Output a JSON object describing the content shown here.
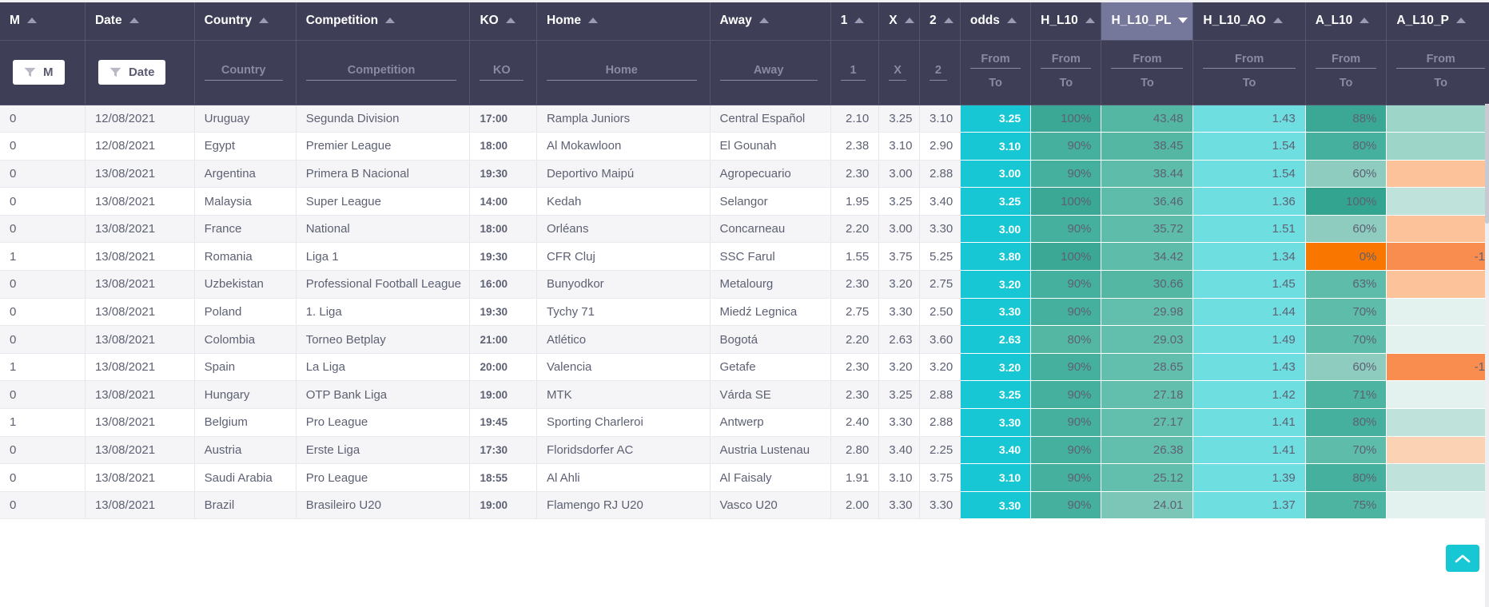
{
  "columns": [
    {
      "key": "m",
      "label": "M",
      "sort": "asc",
      "filter_type": "pill",
      "filter_label": "M",
      "active": false
    },
    {
      "key": "date",
      "label": "Date",
      "sort": "asc",
      "filter_type": "pill",
      "filter_label": "Date",
      "active": false
    },
    {
      "key": "country",
      "label": "Country",
      "sort": "asc",
      "filter_type": "text",
      "filter_label": "Country",
      "active": false
    },
    {
      "key": "comp",
      "label": "Competition",
      "sort": "asc",
      "filter_type": "text",
      "filter_label": "Competition",
      "active": false
    },
    {
      "key": "ko",
      "label": "KO",
      "sort": "asc",
      "filter_type": "text",
      "filter_label": "KO",
      "active": false
    },
    {
      "key": "home",
      "label": "Home",
      "sort": "asc",
      "filter_type": "text",
      "filter_label": "Home",
      "active": false
    },
    {
      "key": "away",
      "label": "Away",
      "sort": "asc",
      "filter_type": "text",
      "filter_label": "Away",
      "active": false
    },
    {
      "key": "one",
      "label": "1",
      "sort": "asc",
      "filter_type": "text",
      "filter_label": "1",
      "active": false
    },
    {
      "key": "x",
      "label": "X",
      "sort": "asc",
      "filter_type": "text",
      "filter_label": "X",
      "active": false
    },
    {
      "key": "two",
      "label": "2",
      "sort": "asc",
      "filter_type": "text",
      "filter_label": "2",
      "active": false
    },
    {
      "key": "odds",
      "label": "odds",
      "sort": "asc",
      "filter_type": "range",
      "filter_from": "From",
      "filter_to": "To",
      "active": false
    },
    {
      "key": "h_l10",
      "label": "H_L10",
      "sort": "asc",
      "filter_type": "range",
      "filter_from": "From",
      "filter_to": "To",
      "active": false
    },
    {
      "key": "h_l10_pl",
      "label": "H_L10_PL",
      "sort": "desc",
      "filter_type": "range",
      "filter_from": "From",
      "filter_to": "To",
      "active": true
    },
    {
      "key": "h_l10_ao",
      "label": "H_L10_AO",
      "sort": "asc",
      "filter_type": "range",
      "filter_from": "From",
      "filter_to": "To",
      "active": false
    },
    {
      "key": "a_l10",
      "label": "A_L10",
      "sort": "asc",
      "filter_type": "range",
      "filter_from": "From",
      "filter_to": "To",
      "active": false
    },
    {
      "key": "a_l10_p",
      "label": "A_L10_P",
      "sort": "asc",
      "filter_type": "range",
      "filter_from": "From",
      "filter_to": "To",
      "active": false
    }
  ],
  "colors": {
    "header_bg": "#3e3e56",
    "header_active_bg": "#75779b",
    "odds_cyan": "#17c8d4",
    "teal_dark": "#3aa894",
    "teal_mid": "#54b7a3",
    "teal_light": "#8fccc0",
    "cyan_light": "#6fdee0",
    "orange_strong": "#f97600",
    "orange_mid": "#f98d4f",
    "orange_light": "#fcc29a",
    "orange_pale": "#fcd2b4",
    "mint_pale": "#e4f2ef",
    "mint_light": "#bfe2da",
    "mint_soft": "#9ed5c9",
    "row_odd": "#ffffff",
    "row_even": "#f5f5f7",
    "text": "#5d6173"
  },
  "rows": [
    {
      "m": "0",
      "date": "12/08/2021",
      "country": "Uruguay",
      "comp": "Segunda Division",
      "ko": "17:00",
      "home": "Rampla Juniors",
      "away": "Central Español",
      "one": "2.10",
      "x": "3.25",
      "two": "3.10",
      "odds": "3.25",
      "h_l10": "100%",
      "h_l10_pl": "43.48",
      "h_l10_ao": "1.43",
      "a_l10": "88%",
      "a_l10_p": "",
      "c_h_l10": "#3aa894",
      "c_h_l10_pl": "#54b7a3",
      "c_h_l10_ao": "#6fdee0",
      "c_a_l10": "#3aa894",
      "c_a_l10_p": "#9ed5c9"
    },
    {
      "m": "0",
      "date": "12/08/2021",
      "country": "Egypt",
      "comp": "Premier League",
      "ko": "18:00",
      "home": "Al Mokawloon",
      "away": "El Gounah",
      "one": "2.38",
      "x": "3.10",
      "two": "2.90",
      "odds": "3.10",
      "h_l10": "90%",
      "h_l10_pl": "38.45",
      "h_l10_ao": "1.54",
      "a_l10": "80%",
      "a_l10_p": "",
      "c_h_l10": "#45b09d",
      "c_h_l10_pl": "#54b7a3",
      "c_h_l10_ao": "#6fdee0",
      "c_a_l10": "#45b09d",
      "c_a_l10_p": "#9ed5c9"
    },
    {
      "m": "0",
      "date": "13/08/2021",
      "country": "Argentina",
      "comp": "Primera B Nacional",
      "ko": "19:30",
      "home": "Deportivo Maipú",
      "away": "Agropecuario",
      "one": "2.30",
      "x": "3.00",
      "two": "2.88",
      "odds": "3.00",
      "h_l10": "90%",
      "h_l10_pl": "38.44",
      "h_l10_ao": "1.54",
      "a_l10": "60%",
      "a_l10_p": "",
      "c_h_l10": "#45b09d",
      "c_h_l10_pl": "#5dbcaa",
      "c_h_l10_ao": "#6fdee0",
      "c_a_l10": "#8fccc0",
      "c_a_l10_p": "#fcc29a"
    },
    {
      "m": "0",
      "date": "13/08/2021",
      "country": "Malaysia",
      "comp": "Super League",
      "ko": "14:00",
      "home": "Kedah",
      "away": "Selangor",
      "one": "1.95",
      "x": "3.25",
      "two": "3.40",
      "odds": "3.25",
      "h_l10": "100%",
      "h_l10_pl": "36.46",
      "h_l10_ao": "1.36",
      "a_l10": "100%",
      "a_l10_p": "",
      "c_h_l10": "#3aa894",
      "c_h_l10_pl": "#5dbcaa",
      "c_h_l10_ao": "#6fdee0",
      "c_a_l10": "#33a48f",
      "c_a_l10_p": "#bfe2da"
    },
    {
      "m": "0",
      "date": "13/08/2021",
      "country": "France",
      "comp": "National",
      "ko": "18:00",
      "home": "Orléans",
      "away": "Concarneau",
      "one": "2.20",
      "x": "3.00",
      "two": "3.30",
      "odds": "3.00",
      "h_l10": "90%",
      "h_l10_pl": "35.72",
      "h_l10_ao": "1.51",
      "a_l10": "60%",
      "a_l10_p": "",
      "c_h_l10": "#45b09d",
      "c_h_l10_pl": "#5dbcaa",
      "c_h_l10_ao": "#6fdee0",
      "c_a_l10": "#8fccc0",
      "c_a_l10_p": "#fcc29a"
    },
    {
      "m": "1",
      "date": "13/08/2021",
      "country": "Romania",
      "comp": "Liga 1",
      "ko": "19:30",
      "home": "CFR Cluj",
      "away": "SSC Farul",
      "one": "1.55",
      "x": "3.75",
      "two": "5.25",
      "odds": "3.80",
      "h_l10": "100%",
      "h_l10_pl": "34.42",
      "h_l10_ao": "1.34",
      "a_l10": "0%",
      "a_l10_p": "-1",
      "c_h_l10": "#3aa894",
      "c_h_l10_pl": "#5dbcaa",
      "c_h_l10_ao": "#6fdee0",
      "c_a_l10": "#f97600",
      "c_a_l10_p": "#f98d4f"
    },
    {
      "m": "0",
      "date": "13/08/2021",
      "country": "Uzbekistan",
      "comp": "Professional Football League",
      "ko": "16:00",
      "home": "Bunyodkor",
      "away": "Metalourg",
      "one": "2.30",
      "x": "3.20",
      "two": "2.75",
      "odds": "3.20",
      "h_l10": "90%",
      "h_l10_pl": "30.66",
      "h_l10_ao": "1.45",
      "a_l10": "63%",
      "a_l10_p": "",
      "c_h_l10": "#45b09d",
      "c_h_l10_pl": "#54b7a3",
      "c_h_l10_ao": "#6fdee0",
      "c_a_l10": "#5dbcaa",
      "c_a_l10_p": "#fcc29a"
    },
    {
      "m": "0",
      "date": "13/08/2021",
      "country": "Poland",
      "comp": "1. Liga",
      "ko": "19:30",
      "home": "Tychy 71",
      "away": "Miedź Legnica",
      "one": "2.75",
      "x": "3.30",
      "two": "2.50",
      "odds": "3.30",
      "h_l10": "90%",
      "h_l10_pl": "29.98",
      "h_l10_ao": "1.44",
      "a_l10": "70%",
      "a_l10_p": "",
      "c_h_l10": "#45b09d",
      "c_h_l10_pl": "#63bfad",
      "c_h_l10_ao": "#6fdee0",
      "c_a_l10": "#5dbcaa",
      "c_a_l10_p": "#e4f2ef"
    },
    {
      "m": "0",
      "date": "13/08/2021",
      "country": "Colombia",
      "comp": "Torneo Betplay",
      "ko": "21:00",
      "home": "Atlético",
      "away": "Bogotá",
      "one": "2.20",
      "x": "2.63",
      "two": "3.60",
      "odds": "2.63",
      "h_l10": "80%",
      "h_l10_pl": "29.03",
      "h_l10_ao": "1.49",
      "a_l10": "70%",
      "a_l10_p": "",
      "c_h_l10": "#54b7a3",
      "c_h_l10_pl": "#63bfad",
      "c_h_l10_ao": "#6fdee0",
      "c_a_l10": "#5dbcaa",
      "c_a_l10_p": "#e4f2ef"
    },
    {
      "m": "1",
      "date": "13/08/2021",
      "country": "Spain",
      "comp": "La Liga",
      "ko": "20:00",
      "home": "Valencia",
      "away": "Getafe",
      "one": "2.30",
      "x": "3.20",
      "two": "3.20",
      "odds": "3.20",
      "h_l10": "90%",
      "h_l10_pl": "28.65",
      "h_l10_ao": "1.43",
      "a_l10": "60%",
      "a_l10_p": "-1",
      "c_h_l10": "#45b09d",
      "c_h_l10_pl": "#63bfad",
      "c_h_l10_ao": "#6fdee0",
      "c_a_l10": "#8fccc0",
      "c_a_l10_p": "#f98d4f"
    },
    {
      "m": "0",
      "date": "13/08/2021",
      "country": "Hungary",
      "comp": "OTP Bank Liga",
      "ko": "19:00",
      "home": "MTK",
      "away": "Várda SE",
      "one": "2.30",
      "x": "3.25",
      "two": "2.88",
      "odds": "3.25",
      "h_l10": "90%",
      "h_l10_pl": "27.18",
      "h_l10_ao": "1.42",
      "a_l10": "71%",
      "a_l10_p": "",
      "c_h_l10": "#45b09d",
      "c_h_l10_pl": "#63bfad",
      "c_h_l10_ao": "#6fdee0",
      "c_a_l10": "#4cb4a0",
      "c_a_l10_p": "#e4f2ef"
    },
    {
      "m": "1",
      "date": "13/08/2021",
      "country": "Belgium",
      "comp": "Pro League",
      "ko": "19:45",
      "home": "Sporting Charleroi",
      "away": "Antwerp",
      "one": "2.40",
      "x": "3.30",
      "two": "2.88",
      "odds": "3.30",
      "h_l10": "90%",
      "h_l10_pl": "27.17",
      "h_l10_ao": "1.41",
      "a_l10": "80%",
      "a_l10_p": "",
      "c_h_l10": "#45b09d",
      "c_h_l10_pl": "#63bfad",
      "c_h_l10_ao": "#6fdee0",
      "c_a_l10": "#45b09d",
      "c_a_l10_p": "#bfe2da"
    },
    {
      "m": "0",
      "date": "13/08/2021",
      "country": "Austria",
      "comp": "Erste Liga",
      "ko": "17:30",
      "home": "Floridsdorfer AC",
      "away": "Austria Lustenau",
      "one": "2.80",
      "x": "3.40",
      "two": "2.25",
      "odds": "3.40",
      "h_l10": "90%",
      "h_l10_pl": "26.38",
      "h_l10_ao": "1.41",
      "a_l10": "70%",
      "a_l10_p": "",
      "c_h_l10": "#45b09d",
      "c_h_l10_pl": "#63bfad",
      "c_h_l10_ao": "#6fdee0",
      "c_a_l10": "#5dbcaa",
      "c_a_l10_p": "#fcd2b4"
    },
    {
      "m": "0",
      "date": "13/08/2021",
      "country": "Saudi Arabia",
      "comp": "Pro League",
      "ko": "18:55",
      "home": "Al Ahli",
      "away": "Al Faisaly",
      "one": "1.91",
      "x": "3.10",
      "two": "3.75",
      "odds": "3.10",
      "h_l10": "90%",
      "h_l10_pl": "25.12",
      "h_l10_ao": "1.39",
      "a_l10": "80%",
      "a_l10_p": "",
      "c_h_l10": "#45b09d",
      "c_h_l10_pl": "#63bfad",
      "c_h_l10_ao": "#6fdee0",
      "c_a_l10": "#45b09d",
      "c_a_l10_p": "#bfe2da"
    },
    {
      "m": "0",
      "date": "13/08/2021",
      "country": "Brazil",
      "comp": "Brasileiro U20",
      "ko": "19:00",
      "home": "Flamengo RJ U20",
      "away": "Vasco U20",
      "one": "2.00",
      "x": "3.30",
      "two": "3.30",
      "odds": "3.30",
      "h_l10": "90%",
      "h_l10_pl": "24.01",
      "h_l10_ao": "1.37",
      "a_l10": "75%",
      "a_l10_p": "",
      "c_h_l10": "#45b09d",
      "c_h_l10_pl": "#7cc6b7",
      "c_h_l10_ao": "#6fdee0",
      "c_a_l10": "#4cb4a0",
      "c_a_l10_p": "#e4f2ef"
    }
  ],
  "scroll_top_button": {
    "icon": "chevron-up-icon",
    "label": ""
  }
}
